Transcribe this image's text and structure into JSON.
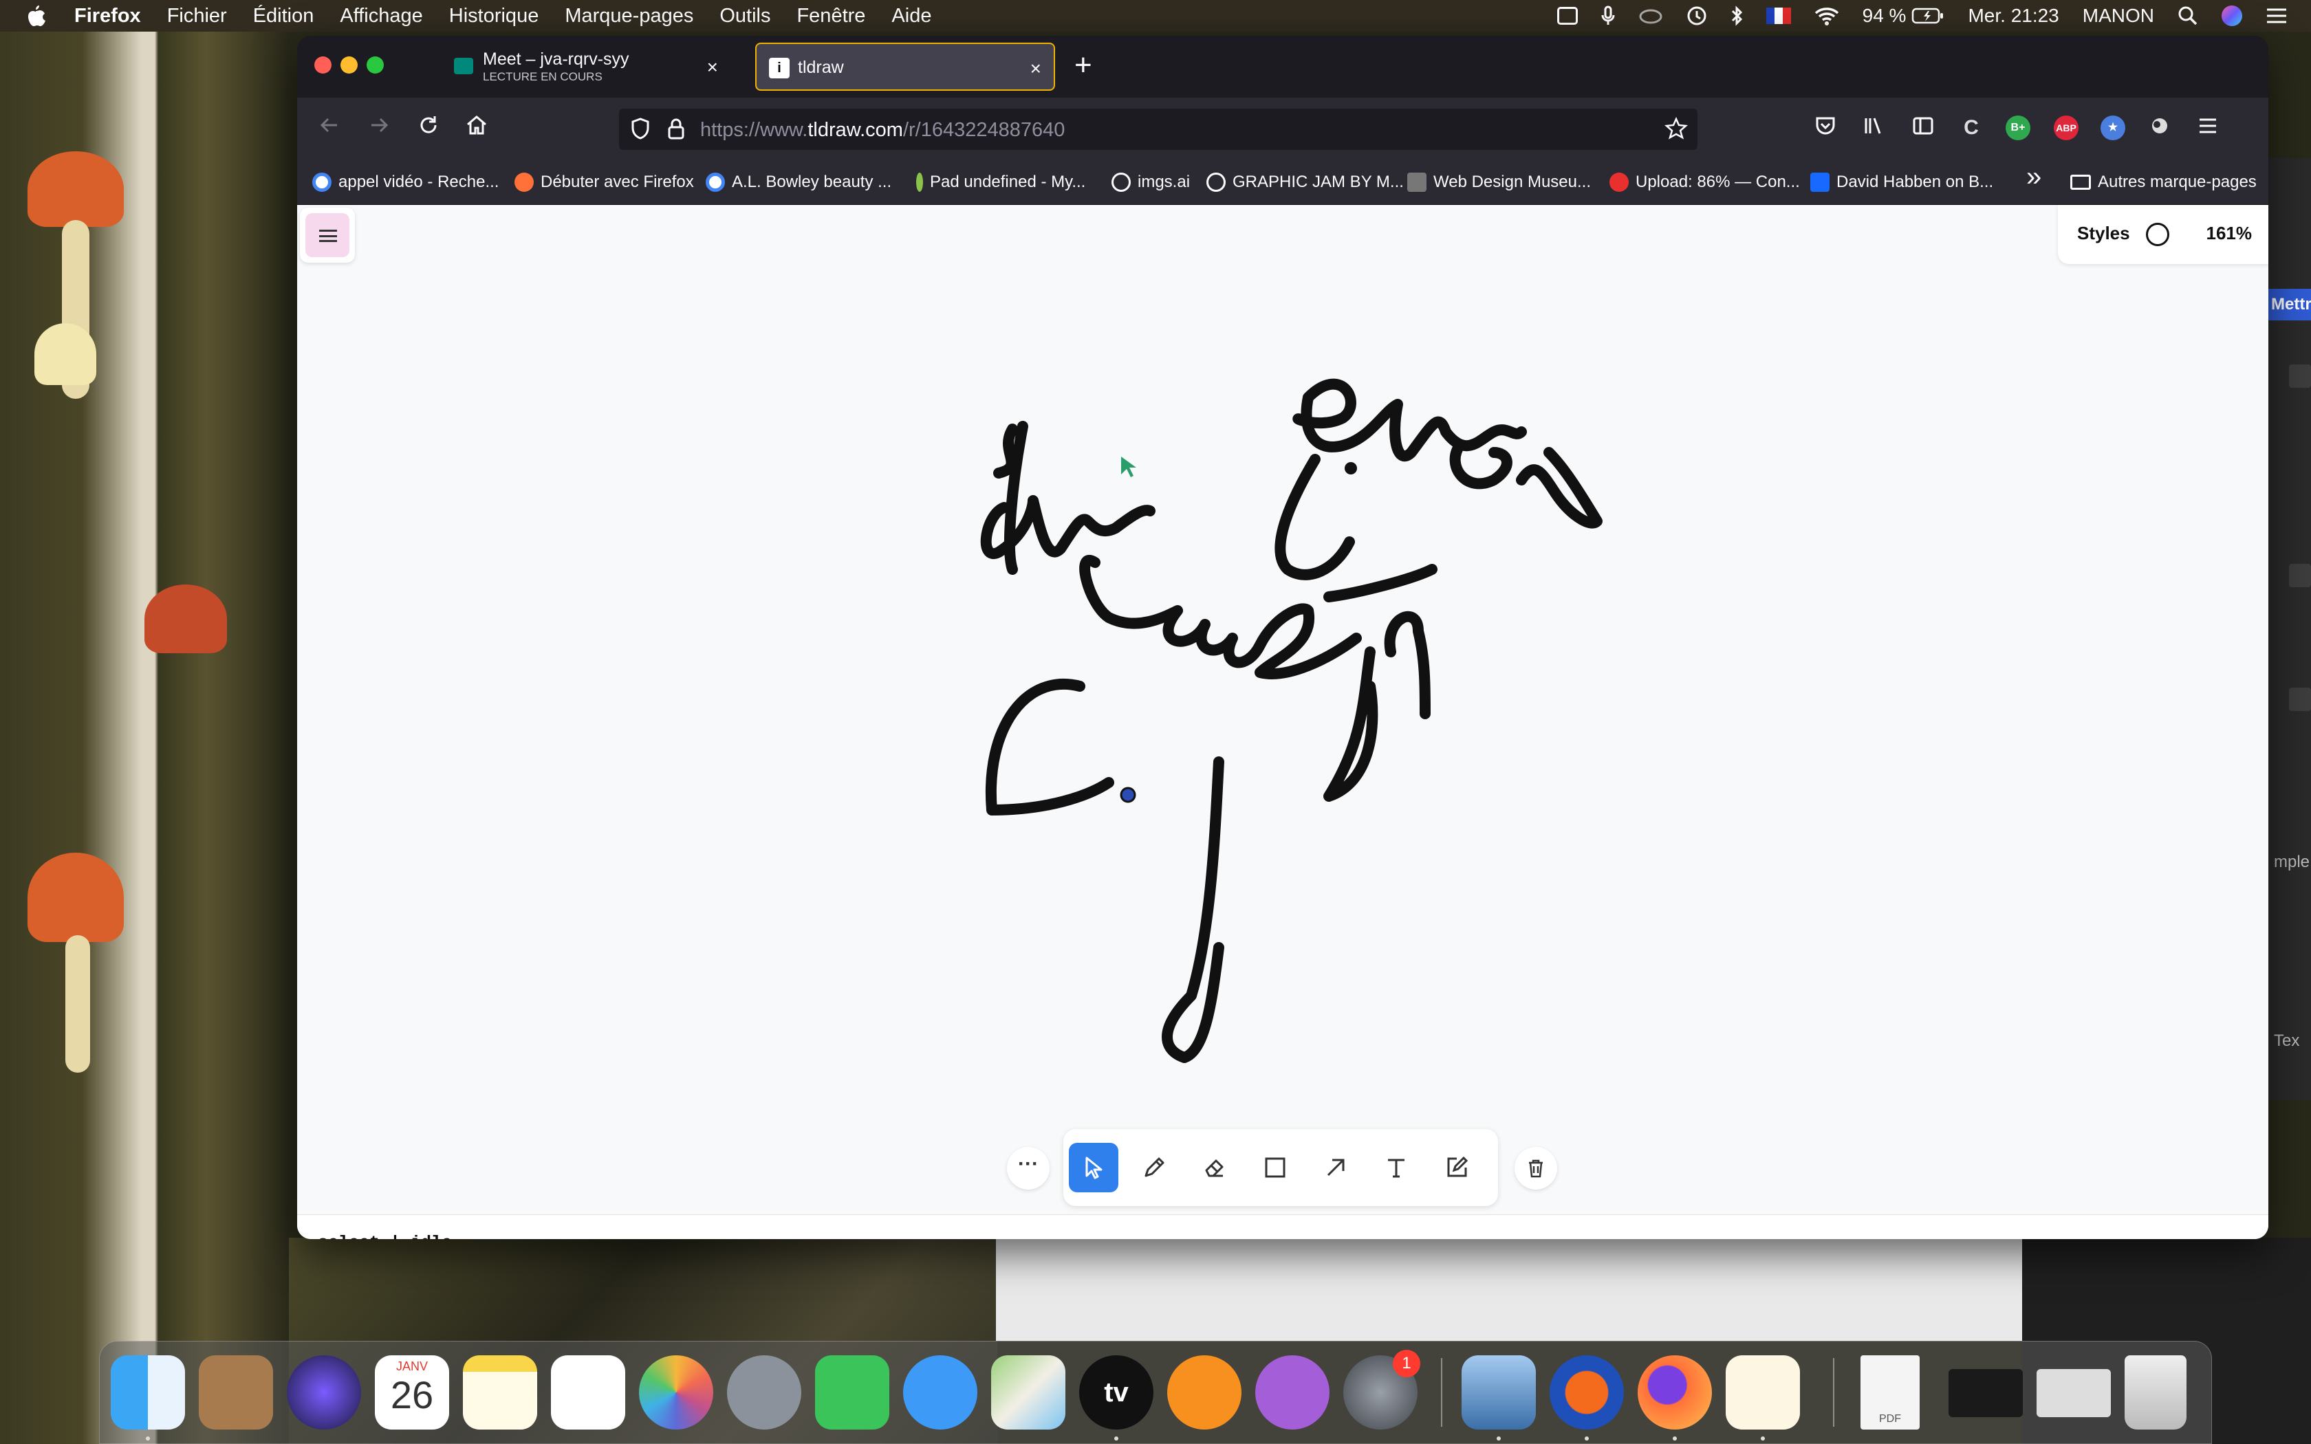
{
  "menubar": {
    "app_name": "Firefox",
    "menus": [
      "Fichier",
      "Édition",
      "Affichage",
      "Historique",
      "Marque-pages",
      "Outils",
      "Fenêtre",
      "Aide"
    ],
    "battery": "94 %",
    "clock": "Mer. 21:23",
    "user": "MANON"
  },
  "tabs": [
    {
      "title": "Meet – jva-rqrv-syy",
      "subtitle": "LECTURE EN COURS",
      "close": "×"
    },
    {
      "title": "tldraw",
      "favicon": "i",
      "close": "×"
    }
  ],
  "new_tab": "+",
  "navbar": {
    "url_prefix": "https://www.",
    "url_domain": "tldraw.com",
    "url_path": "/r/1643224887640"
  },
  "toolbar_icons": {
    "adblock": "ABP",
    "bplus": "B+"
  },
  "bookmarks": [
    {
      "label": "appel vidéo - Reche...",
      "color": "#ffffff"
    },
    {
      "label": "Débuter avec Firefox",
      "color": "#ff7139"
    },
    {
      "label": "A.L. Bowley beauty ...",
      "color": "#ffffff"
    },
    {
      "label": "Pad undefined - My...",
      "color": "#2b2a33"
    },
    {
      "label": "imgs.ai",
      "color": "#2b2a33"
    },
    {
      "label": "GRAPHIC JAM BY M...",
      "color": "#2b2a33"
    },
    {
      "label": "Web Design Museu...",
      "color": "#555555"
    },
    {
      "label": "Upload: 86% — Con...",
      "color": "#e8312f"
    },
    {
      "label": "David Habben on B...",
      "color": "#1769ff"
    }
  ],
  "bookmarks_more": "»",
  "other_bookmarks": "Autres marque-pages",
  "tldraw": {
    "styles_label": "Styles",
    "zoom": "161%",
    "more_label": "···",
    "status": "select | idle"
  },
  "dock": {
    "calendar_month": "JANV",
    "calendar_day": "26",
    "settings_badge": "1",
    "tv_label": "tv",
    "pdf_label": "PDF"
  },
  "right_app": {
    "label": "Mettre",
    "text_a": "Tex",
    "text_b": "mple"
  }
}
